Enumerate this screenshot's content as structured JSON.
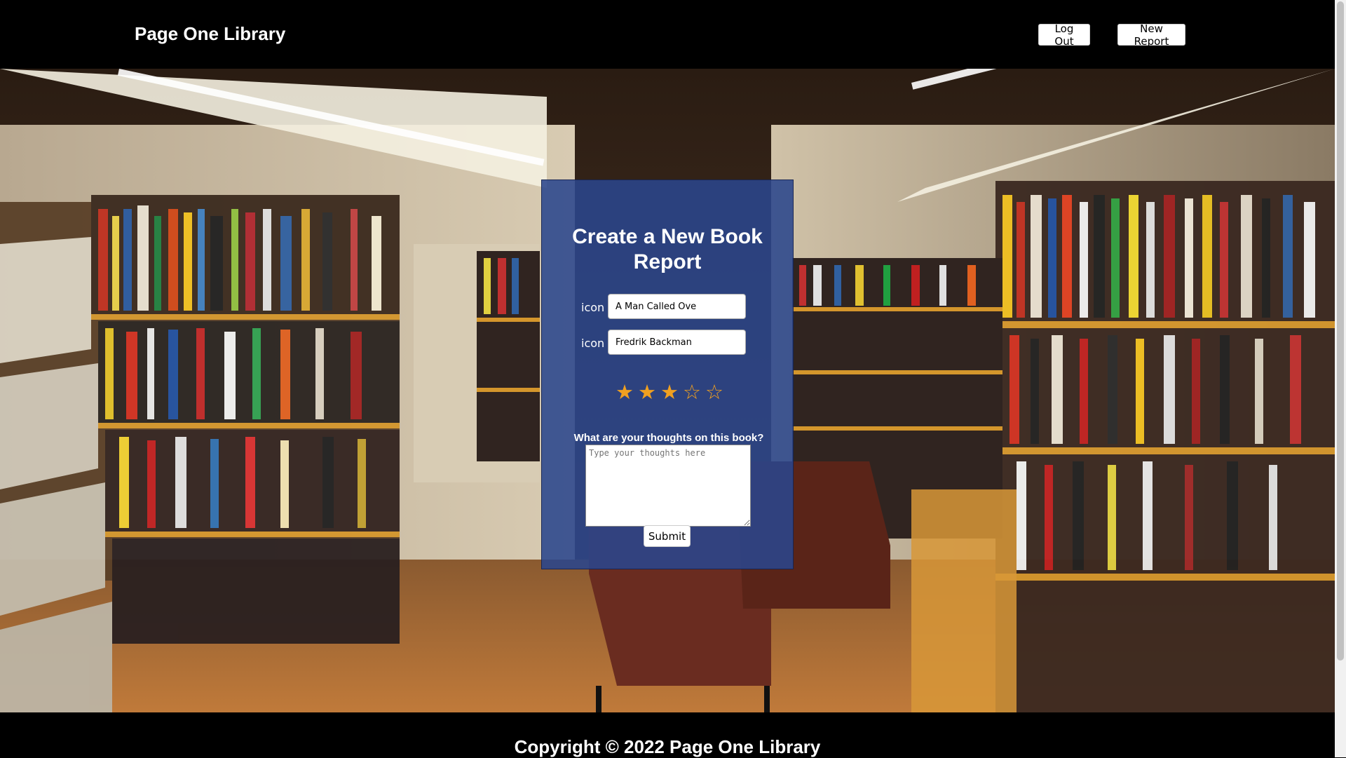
{
  "header": {
    "brand": "Page One Library",
    "logout_label": "Log Out",
    "new_report_label": "New Report"
  },
  "form": {
    "title": "Create a New Book Report",
    "title_field": {
      "icon_label": "icon",
      "value": "A Man Called Ove"
    },
    "author_field": {
      "icon_label": "icon",
      "value": "Fredrik Backman"
    },
    "rating": {
      "value": 3,
      "max": 5,
      "filled_glyph": "★",
      "empty_glyph": "☆"
    },
    "thoughts_label": "What are your thoughts on this book?",
    "thoughts_placeholder": "Type your thoughts here",
    "submit_label": "Submit"
  },
  "footer": {
    "copyright": "Copyright © 2022 Page One Library"
  },
  "colors": {
    "panel_bg": "#2a468c",
    "star": "#f0a020",
    "bar_bg": "#000000"
  }
}
